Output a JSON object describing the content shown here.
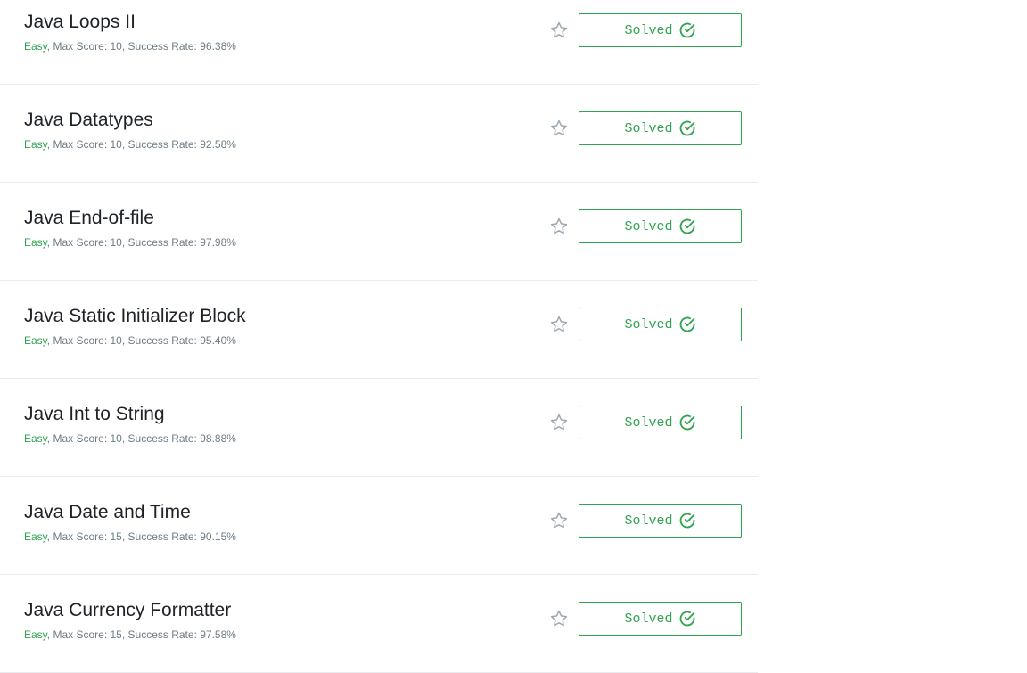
{
  "challenges": [
    {
      "title": "Java Loops II",
      "difficulty": "Easy",
      "max_score_text": "Max Score: 10",
      "success_rate_text": "Success Rate: 96.38%",
      "status": "Solved"
    },
    {
      "title": "Java Datatypes",
      "difficulty": "Easy",
      "max_score_text": "Max Score: 10",
      "success_rate_text": "Success Rate: 92.58%",
      "status": "Solved"
    },
    {
      "title": "Java End-of-file",
      "difficulty": "Easy",
      "max_score_text": "Max Score: 10",
      "success_rate_text": "Success Rate: 97.98%",
      "status": "Solved"
    },
    {
      "title": "Java Static Initializer Block",
      "difficulty": "Easy",
      "max_score_text": "Max Score: 10",
      "success_rate_text": "Success Rate: 95.40%",
      "status": "Solved"
    },
    {
      "title": "Java Int to String",
      "difficulty": "Easy",
      "max_score_text": "Max Score: 10",
      "success_rate_text": "Success Rate: 98.88%",
      "status": "Solved"
    },
    {
      "title": "Java Date and Time",
      "difficulty": "Easy",
      "max_score_text": "Max Score: 15",
      "success_rate_text": "Success Rate: 90.15%",
      "status": "Solved"
    },
    {
      "title": "Java Currency Formatter",
      "difficulty": "Easy",
      "max_score_text": "Max Score: 15",
      "success_rate_text": "Success Rate: 97.58%",
      "status": "Solved"
    }
  ],
  "icons": {
    "star": "star-outline-icon",
    "solved": "check-circle-icon"
  },
  "colors": {
    "accent_green": "#2ea44f",
    "meta_gray": "#6e7c86",
    "star_gray": "#9aa7b0"
  }
}
